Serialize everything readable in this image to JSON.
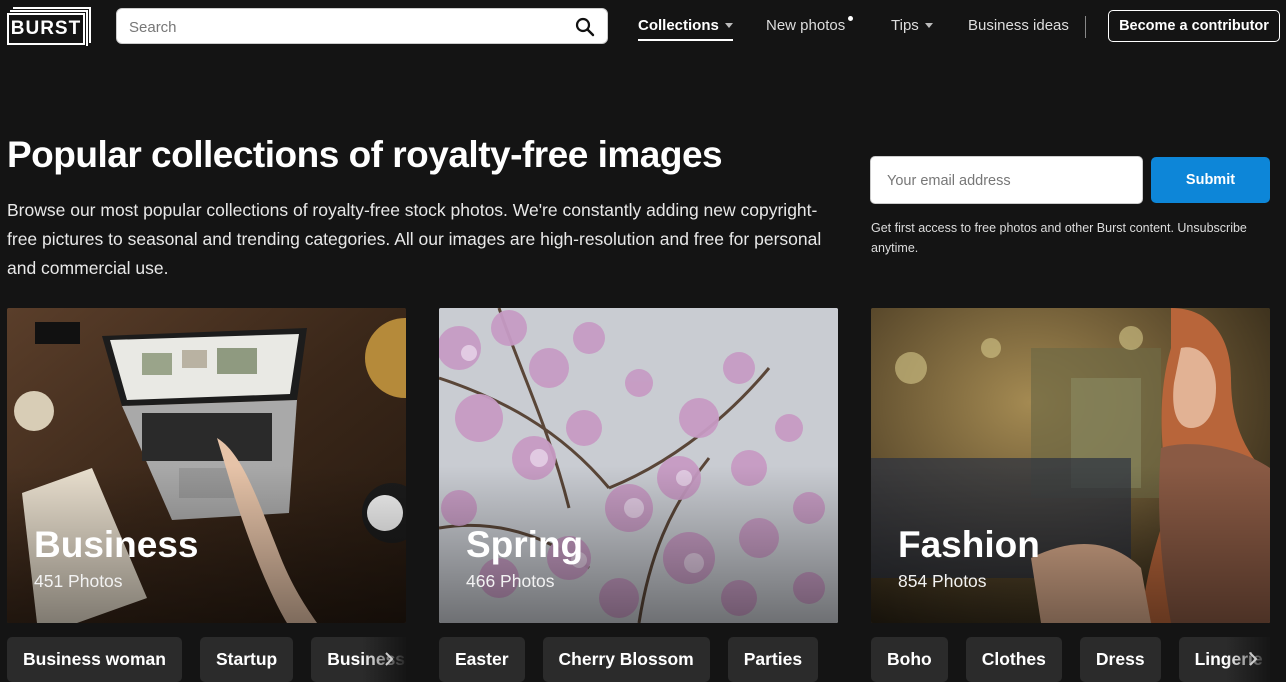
{
  "header": {
    "logo": "BURST",
    "search_placeholder": "Search",
    "nav": [
      {
        "label": "Collections",
        "active": true,
        "has_caret": true
      },
      {
        "label": "New photos",
        "has_dot": true
      },
      {
        "label": "Tips",
        "has_caret": true
      },
      {
        "label": "Business ideas"
      }
    ],
    "contributor_label": "Become a contributor"
  },
  "hero": {
    "title": "Popular collections of royalty-free images",
    "description": "Browse our most popular collections of royalty-free stock photos. We're constantly adding new copyright-free pictures to seasonal and trending categories. All our images are high-resolution and free for personal and commercial use.",
    "email_placeholder": "Your email address",
    "submit_label": "Submit",
    "fine_print": "Get first access to free photos and other Burst content. Unsubscribe anytime."
  },
  "collections": [
    {
      "title": "Business",
      "count": "451 Photos",
      "tags": [
        "Business woman",
        "Startup",
        "Business"
      ]
    },
    {
      "title": "Spring",
      "count": "466 Photos",
      "tags": [
        "Easter",
        "Cherry Blossom",
        "Parties"
      ]
    },
    {
      "title": "Fashion",
      "count": "854 Photos",
      "tags": [
        "Boho",
        "Clothes",
        "Dress",
        "Lingerie"
      ]
    }
  ],
  "colors": {
    "background": "#141414",
    "accent": "#0d86d8"
  }
}
